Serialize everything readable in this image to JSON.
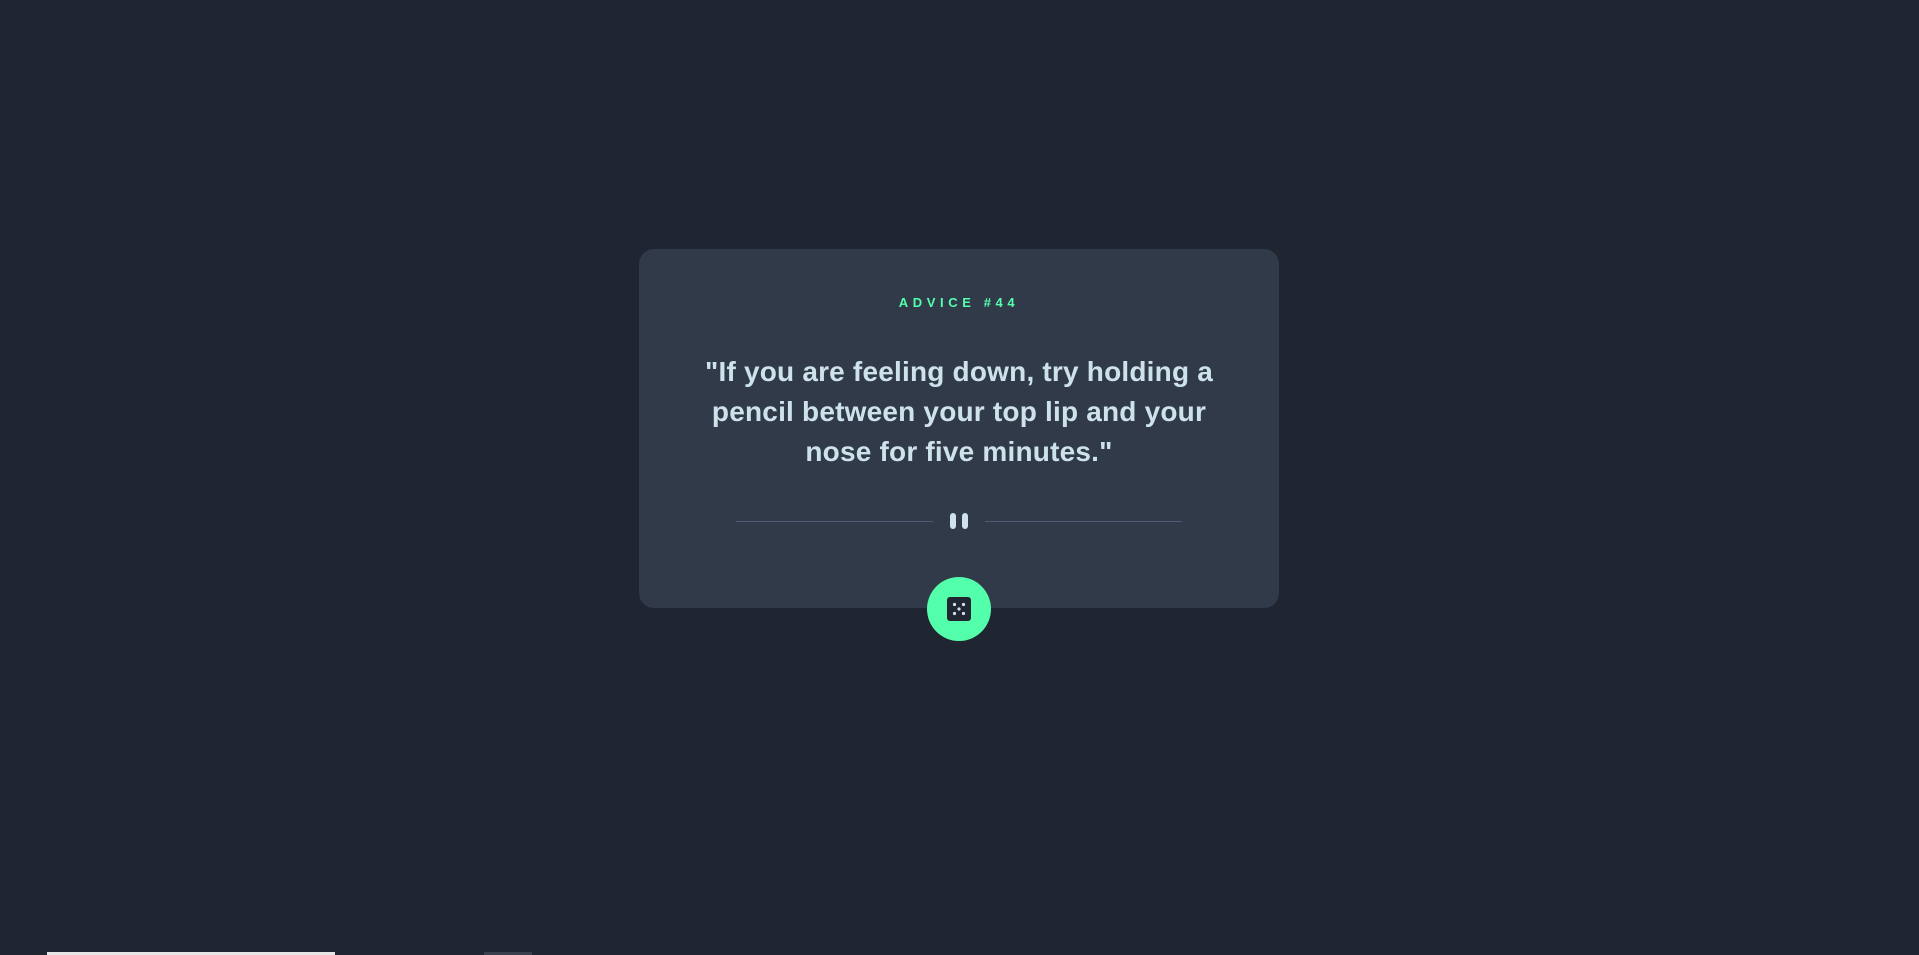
{
  "card": {
    "advice_label": "Advice #44",
    "quote": "\"If you are feeling down, try holding a pencil between your top lip and your nose for five minutes.\""
  },
  "divider": {
    "icon": "pause-icon"
  },
  "actions": {
    "dice_button_icon": "dice-icon"
  },
  "colors": {
    "background": "#1f2632",
    "card": "#313a49",
    "accent": "#53ffab",
    "text": "#cee3e9",
    "divider": "#4f5d74"
  }
}
